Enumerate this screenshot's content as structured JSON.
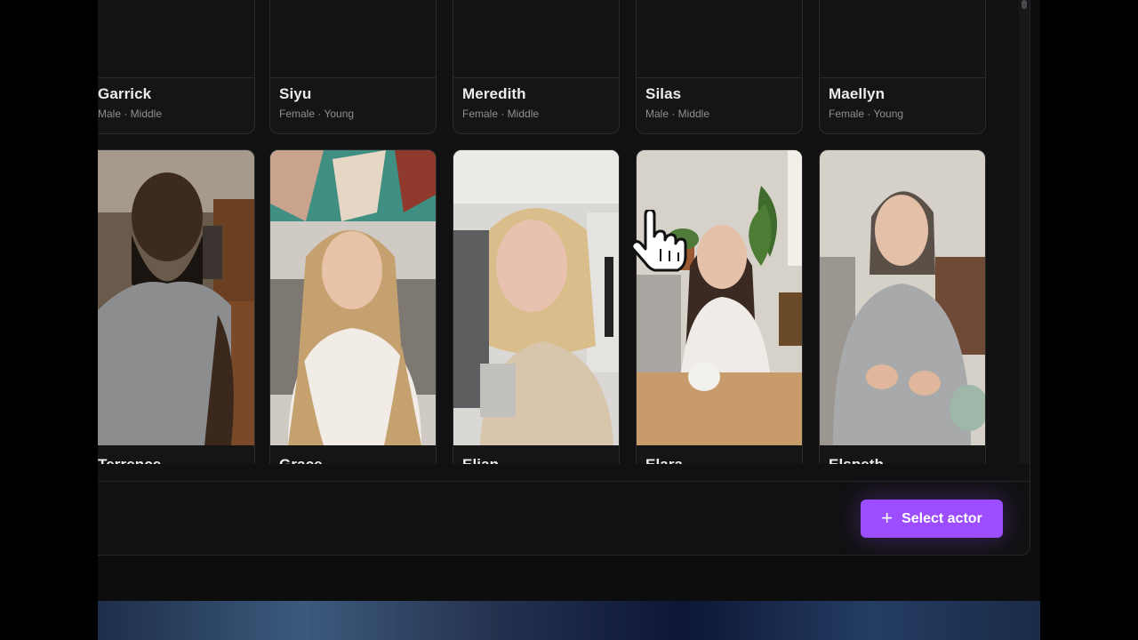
{
  "actors_row1": [
    {
      "name": "Garrick",
      "meta": "Male · Middle"
    },
    {
      "name": "Siyu",
      "meta": "Female · Young"
    },
    {
      "name": "Meredith",
      "meta": "Female · Middle"
    },
    {
      "name": "Silas",
      "meta": "Male · Middle"
    },
    {
      "name": "Maellyn",
      "meta": "Female · Young"
    }
  ],
  "actors_row2": [
    {
      "name": "Terrence"
    },
    {
      "name": "Grace"
    },
    {
      "name": "Elian"
    },
    {
      "name": "Elara"
    },
    {
      "name": "Elspeth"
    }
  ],
  "footer": {
    "select_label": "Select actor",
    "select_icon": "plus-icon"
  },
  "colors": {
    "accent": "#9b4dff",
    "background": "#111112"
  }
}
